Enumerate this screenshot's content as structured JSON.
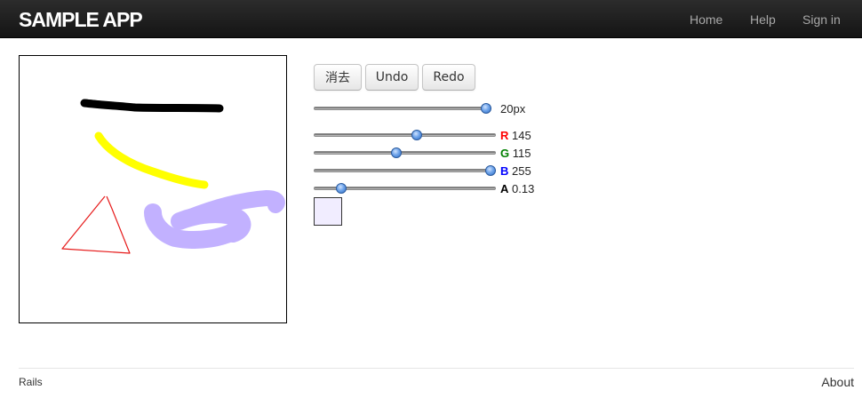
{
  "navbar": {
    "brand": "SAMPLE APP",
    "links": [
      "Home",
      "Help",
      "Sign in"
    ]
  },
  "toolbar": {
    "clear_label": "消去",
    "undo_label": "Undo",
    "redo_label": "Redo"
  },
  "brush": {
    "size_value": 20,
    "size_label": "20px",
    "size_max": 20
  },
  "color": {
    "r": {
      "channel": "R",
      "value": "145",
      "level": 145,
      "max": 255,
      "color": "#ff0000"
    },
    "g": {
      "channel": "G",
      "value": "115",
      "level": 115,
      "max": 255,
      "color": "#008000"
    },
    "b": {
      "channel": "B",
      "value": "255",
      "level": 255,
      "max": 255,
      "color": "#0000ff"
    },
    "a": {
      "channel": "A",
      "value": "0.13",
      "level": 0.13,
      "max": 1,
      "color": "#000000"
    }
  },
  "canvas": {
    "strokes": [
      {
        "name": "black-stroke",
        "color": "#000000"
      },
      {
        "name": "yellow-stroke",
        "color": "#ffff00"
      },
      {
        "name": "red-triangle-stroke",
        "color": "#ff0000"
      },
      {
        "name": "translucent-purple-stroke",
        "color": "#9173ff"
      }
    ]
  },
  "footer": {
    "left": "Rails",
    "right": "About"
  }
}
